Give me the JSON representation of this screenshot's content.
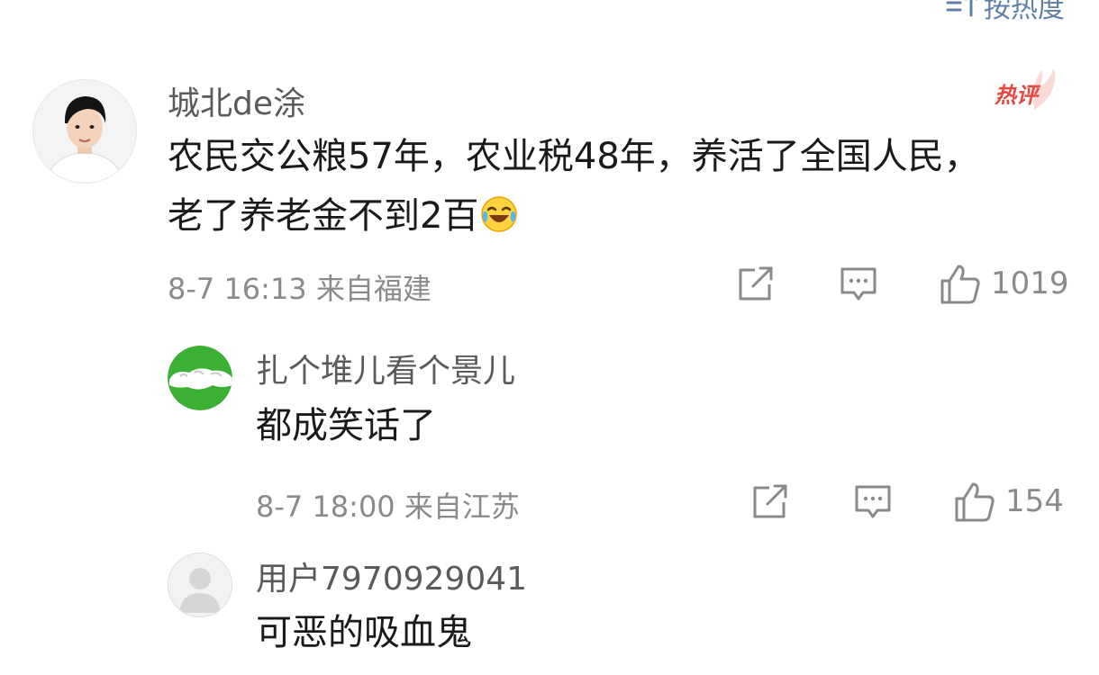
{
  "sort_bar": {
    "label": "按热度",
    "icon": "sort-icon",
    "color": "#5f7fa8"
  },
  "comments": [
    {
      "username": "城北de涂",
      "content": "农民交公粮57年，农业税48年，养活了全国人民，老了养老金不到2百",
      "emoji": "laughing-crying-emoji",
      "time": "8-7 16:13 来自福建",
      "likes": "1019",
      "badge": "热评",
      "avatar": "user-photo-avatar"
    },
    {
      "username": "扎个堆儿看个景儿",
      "content": "都成笑话了",
      "time": "8-7 18:00 来自江苏",
      "likes": "154",
      "avatar": "green-avatar"
    },
    {
      "username": "用户7970929041",
      "content": "可恶的吸血鬼",
      "avatar": "default-avatar"
    }
  ],
  "colors": {
    "badge": "#e8473f",
    "link": "#5f7fa8",
    "meta": "#8a8a8a",
    "username": "#5a5a5a",
    "text": "#1a1a1a",
    "green_avatar": "#3cb034"
  }
}
